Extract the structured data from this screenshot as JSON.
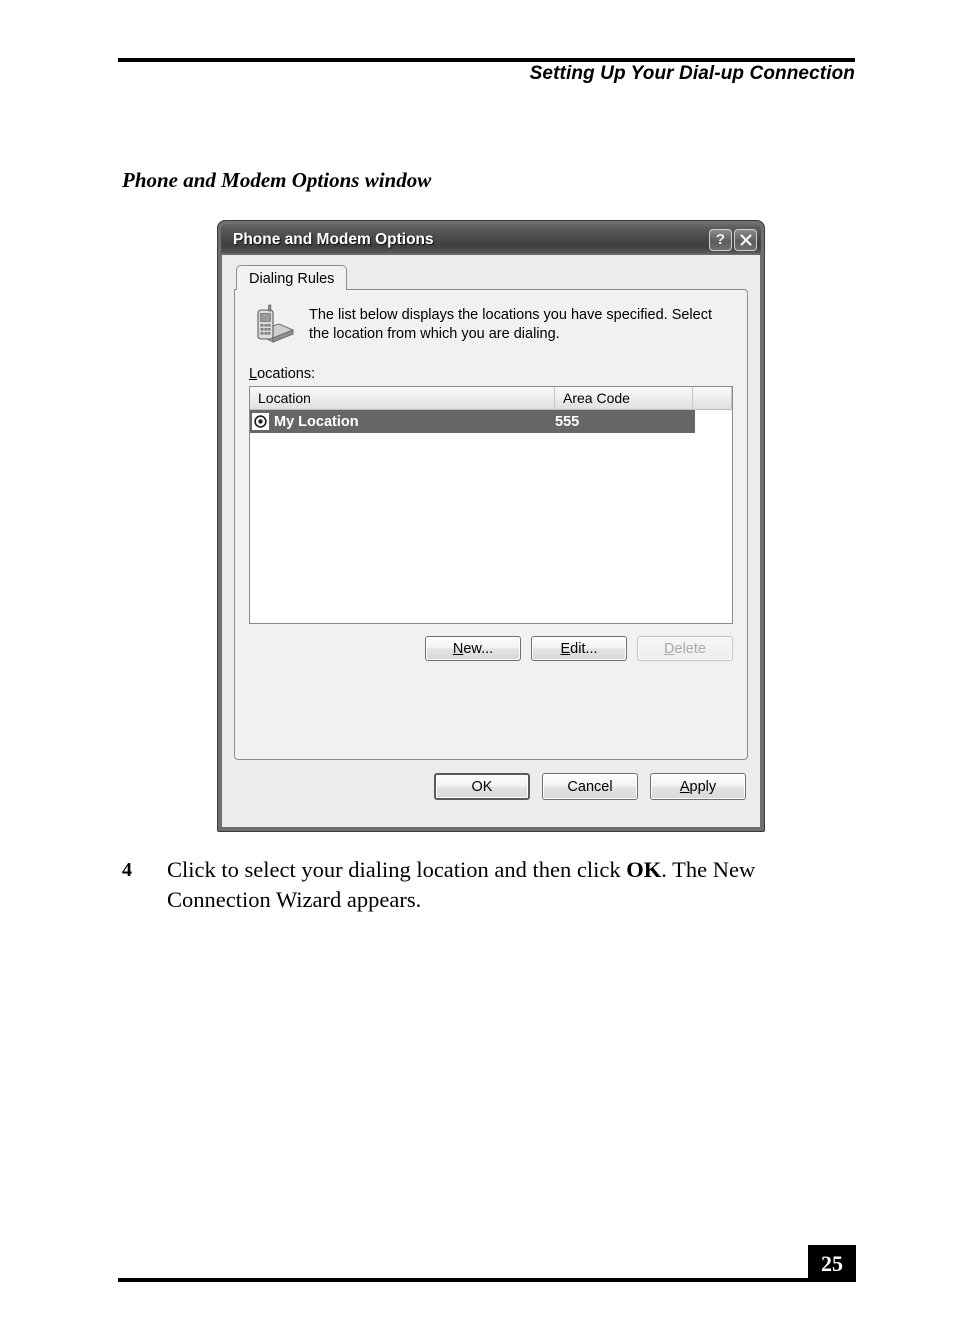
{
  "page": {
    "running_header": "Setting Up Your Dial-up Connection",
    "section_heading": "Phone and Modem Options window",
    "page_number": "25"
  },
  "step": {
    "number": "4",
    "text_before": "Click to select your dialing location and then click ",
    "emphasis": "OK",
    "text_after": ". The New Connection Wizard appears."
  },
  "dialog": {
    "title": "Phone and Modem Options",
    "titlebar_buttons": [
      {
        "name": "help-button",
        "label": "?"
      },
      {
        "name": "close-button",
        "label": "×"
      }
    ],
    "tabs": [
      {
        "label": "Dialing Rules",
        "selected": true
      }
    ],
    "description": "The list below displays the locations you have specified. Select the location from which you are dialing.",
    "icon": "phone-and-modem-icon",
    "locations_label": "Locations:",
    "locations_label_accel": "L",
    "listview": {
      "columns": [
        "Location",
        "Area Code"
      ],
      "rows": [
        {
          "location": "My Location",
          "area_code": "555",
          "selected": true
        }
      ]
    },
    "list_buttons": [
      {
        "name": "new-button",
        "label": "New...",
        "accel": "N",
        "enabled": true
      },
      {
        "name": "edit-button",
        "label": "Edit...",
        "accel": "E",
        "enabled": true
      },
      {
        "name": "delete-button",
        "label": "Delete",
        "accel": "D",
        "enabled": false
      }
    ],
    "dialog_buttons": [
      {
        "name": "ok-button",
        "label": "OK",
        "default": true
      },
      {
        "name": "cancel-button",
        "label": "Cancel",
        "default": false
      },
      {
        "name": "apply-button",
        "label": "Apply",
        "accel": "A",
        "default": false
      }
    ]
  },
  "colors": {
    "titlebar_dark": "#4a4a4a",
    "selection": "#666666",
    "dialog_face": "#ececec",
    "panel_face": "#f1f1f1"
  }
}
